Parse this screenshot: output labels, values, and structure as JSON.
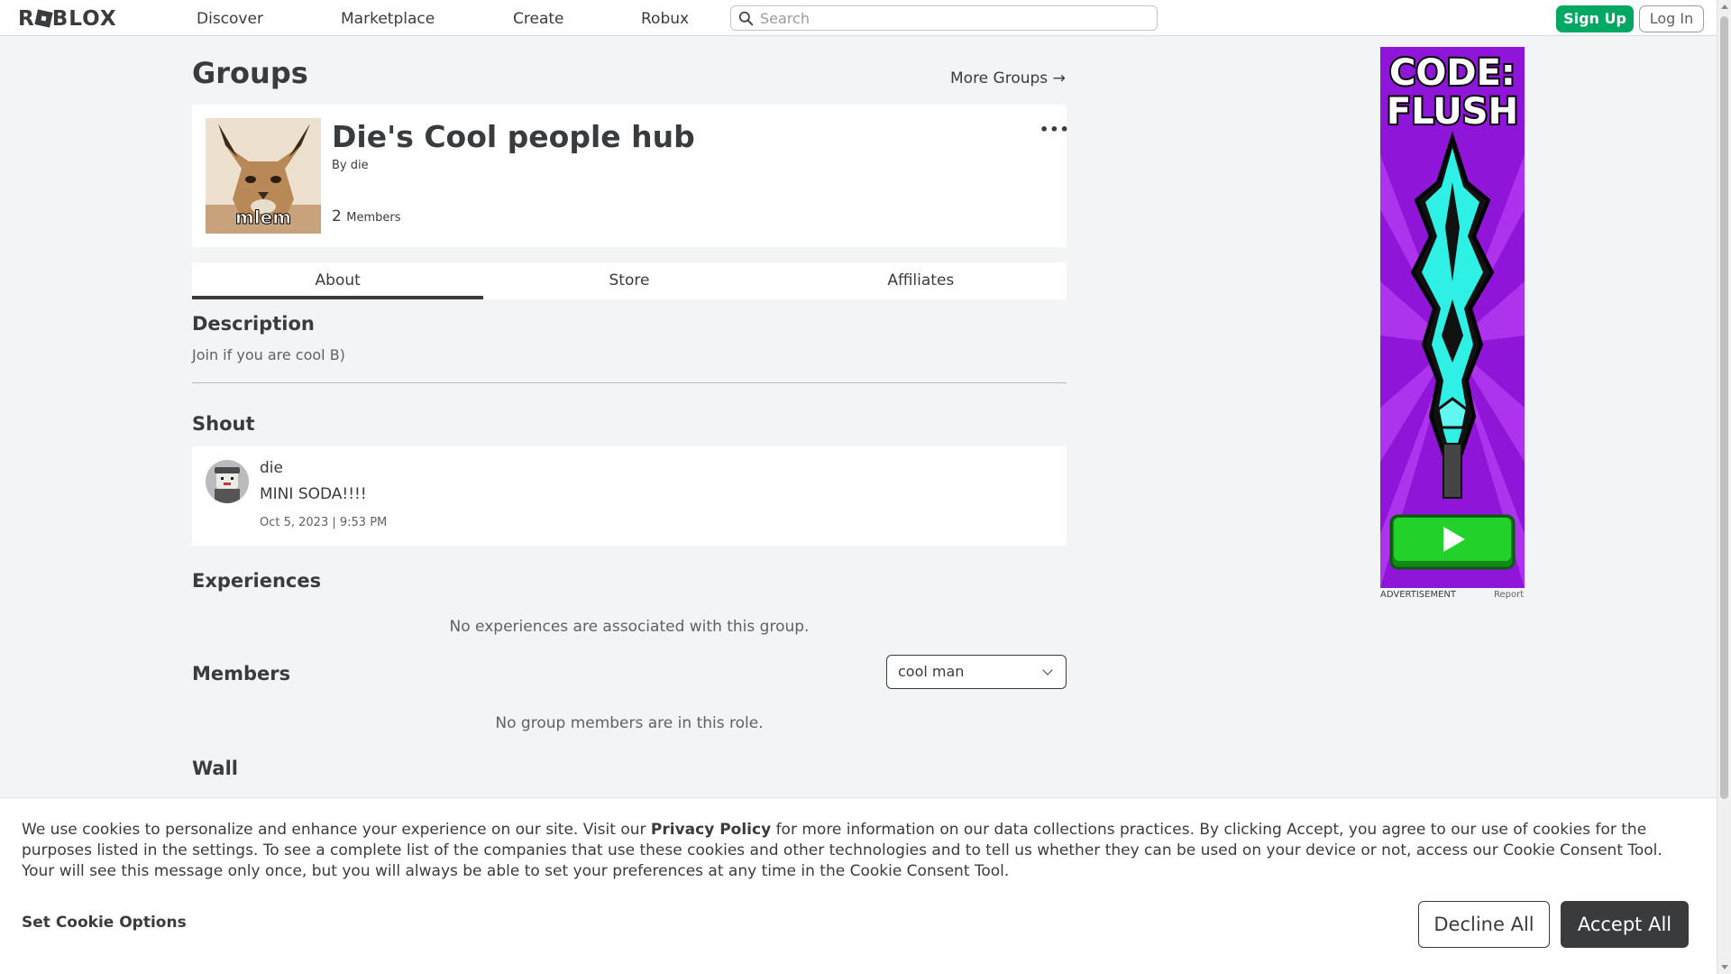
{
  "header": {
    "logo": "ROBLOX",
    "nav": [
      "Discover",
      "Marketplace",
      "Create",
      "Robux"
    ],
    "search_placeholder": "Search",
    "signup": "Sign Up",
    "login": "Log In"
  },
  "page": {
    "title": "Groups",
    "more_groups": "More Groups →"
  },
  "group": {
    "name": "Die's Cool people hub",
    "by_label": "By",
    "owner": "die",
    "member_count": "2",
    "member_label": "Members",
    "thumb_caption": "mlem"
  },
  "tabs": [
    "About",
    "Store",
    "Affiliates"
  ],
  "description": {
    "heading": "Description",
    "text": "Join if you are cool B)"
  },
  "shout": {
    "heading": "Shout",
    "user": "die",
    "message": "MINI SODA!!!!",
    "date": "Oct 5, 2023 | 9:53 PM"
  },
  "experiences": {
    "heading": "Experiences",
    "empty": "No experiences are associated with this group."
  },
  "members": {
    "heading": "Members",
    "selected_role": "cool man",
    "empty": "No group members are in this role."
  },
  "wall": {
    "heading": "Wall"
  },
  "ad": {
    "title_line1": "CODE:",
    "title_line2": "FLUSH",
    "label": "ADVERTISEMENT",
    "report": "Report"
  },
  "cookie": {
    "text_before": "We use cookies to personalize and enhance your experience on our site. Visit our ",
    "privacy_link": "Privacy Policy",
    "text_after": " for more information on our data collections practices. By clicking Accept, you agree to our use of cookies for the purposes listed in the settings. To see a complete list of the companies that use these cookies and other technologies and to tell us whether they can be used on your device or not, access our Cookie Consent Tool. Your will see this message only once, but you will always be able to set your preferences at any time in the Cookie Consent Tool.",
    "set_options": "Set Cookie Options",
    "decline": "Decline All",
    "accept": "Accept All"
  },
  "colors": {
    "signup_green": "#00a862",
    "dark": "#393b3d",
    "ad_purple": "#8f16d8",
    "ad_cyan": "#2ef0e4",
    "ad_play_green": "#22d12a"
  },
  "icons": [
    "search-icon",
    "more-dots-icon",
    "chevron-down-icon",
    "arrow-right-icon",
    "play-icon"
  ]
}
